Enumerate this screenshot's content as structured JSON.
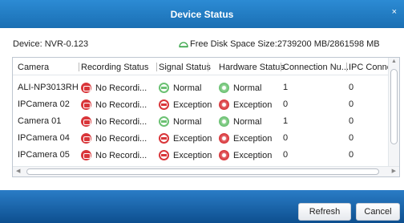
{
  "window": {
    "title": "Device Status",
    "close_glyph": "×"
  },
  "info": {
    "device": "Device: NVR-0.123",
    "disk": "Free Disk Space Size:2739200 MB/2861598 MB",
    "disk_icon": "disk-space-icon"
  },
  "table": {
    "columns": [
      "Camera",
      "Recording Status",
      "Signal Status",
      "Hardware Status",
      "Connection Nu...",
      "IPC Connectio"
    ],
    "rows": [
      {
        "camera": "ALI-NP3013RH",
        "recording": "No Recordi...",
        "signal": "Normal",
        "signal_state": "ok",
        "hardware": "Normal",
        "hardware_state": "ok",
        "connection": "1",
        "ipc": "0"
      },
      {
        "camera": "IPCamera 02",
        "recording": "No Recordi...",
        "signal": "Exception",
        "signal_state": "bad",
        "hardware": "Exception",
        "hardware_state": "bad",
        "connection": "0",
        "ipc": "0"
      },
      {
        "camera": "Camera 01",
        "recording": "No Recordi...",
        "signal": "Normal",
        "signal_state": "ok",
        "hardware": "Normal",
        "hardware_state": "ok",
        "connection": "1",
        "ipc": "0"
      },
      {
        "camera": "IPCamera 04",
        "recording": "No Recordi...",
        "signal": "Exception",
        "signal_state": "bad",
        "hardware": "Exception",
        "hardware_state": "bad",
        "connection": "0",
        "ipc": "0"
      },
      {
        "camera": "IPCamera 05",
        "recording": "No Recordi...",
        "signal": "Exception",
        "signal_state": "bad",
        "hardware": "Exception",
        "hardware_state": "bad",
        "connection": "0",
        "ipc": "0"
      }
    ]
  },
  "buttons": {
    "refresh": "Refresh",
    "cancel": "Cancel"
  },
  "colors": {
    "title_bar": "#1a6fb3",
    "footer": "#0d4f8f",
    "ok": "#6bc173",
    "error": "#d9363a"
  }
}
